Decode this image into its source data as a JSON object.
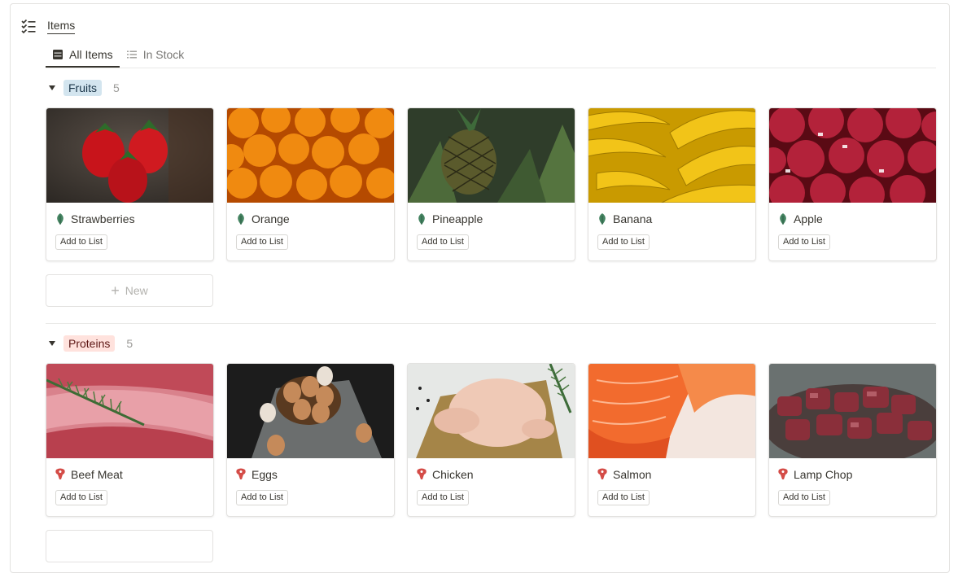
{
  "database": {
    "title": "Items",
    "icon": "checklist-icon"
  },
  "tabs": [
    {
      "label": "All Items",
      "icon": "table-icon",
      "active": true
    },
    {
      "label": "In Stock",
      "icon": "list-icon",
      "active": false
    }
  ],
  "groups": [
    {
      "name": "Fruits",
      "count": "5",
      "tag_bg": "#d3e5ef",
      "tag_color": "#183347",
      "icon": "leaf-icon",
      "items": [
        {
          "name": "Strawberries",
          "button": "Add to List",
          "image": "strawberries-photo"
        },
        {
          "name": "Orange",
          "button": "Add to List",
          "image": "oranges-photo"
        },
        {
          "name": "Pineapple",
          "button": "Add to List",
          "image": "pineapple-photo"
        },
        {
          "name": "Banana",
          "button": "Add to List",
          "image": "bananas-photo"
        },
        {
          "name": "Apple",
          "button": "Add to List",
          "image": "apples-photo"
        }
      ],
      "new_label": "New"
    },
    {
      "name": "Proteins",
      "count": "5",
      "tag_bg": "#ffe2dd",
      "tag_color": "#5d1715",
      "icon": "meat-icon",
      "items": [
        {
          "name": "Beef Meat",
          "button": "Add to List",
          "image": "beef-photo"
        },
        {
          "name": "Eggs",
          "button": "Add to List",
          "image": "eggs-photo"
        },
        {
          "name": "Chicken",
          "button": "Add to List",
          "image": "chicken-photo"
        },
        {
          "name": "Salmon",
          "button": "Add to List",
          "image": "salmon-photo"
        },
        {
          "name": "Lamp Chop",
          "button": "Add to List",
          "image": "lamb-photo"
        }
      ]
    }
  ],
  "colors": {
    "leaf_icon": "#448361",
    "meat_icon": "#d44c47"
  }
}
